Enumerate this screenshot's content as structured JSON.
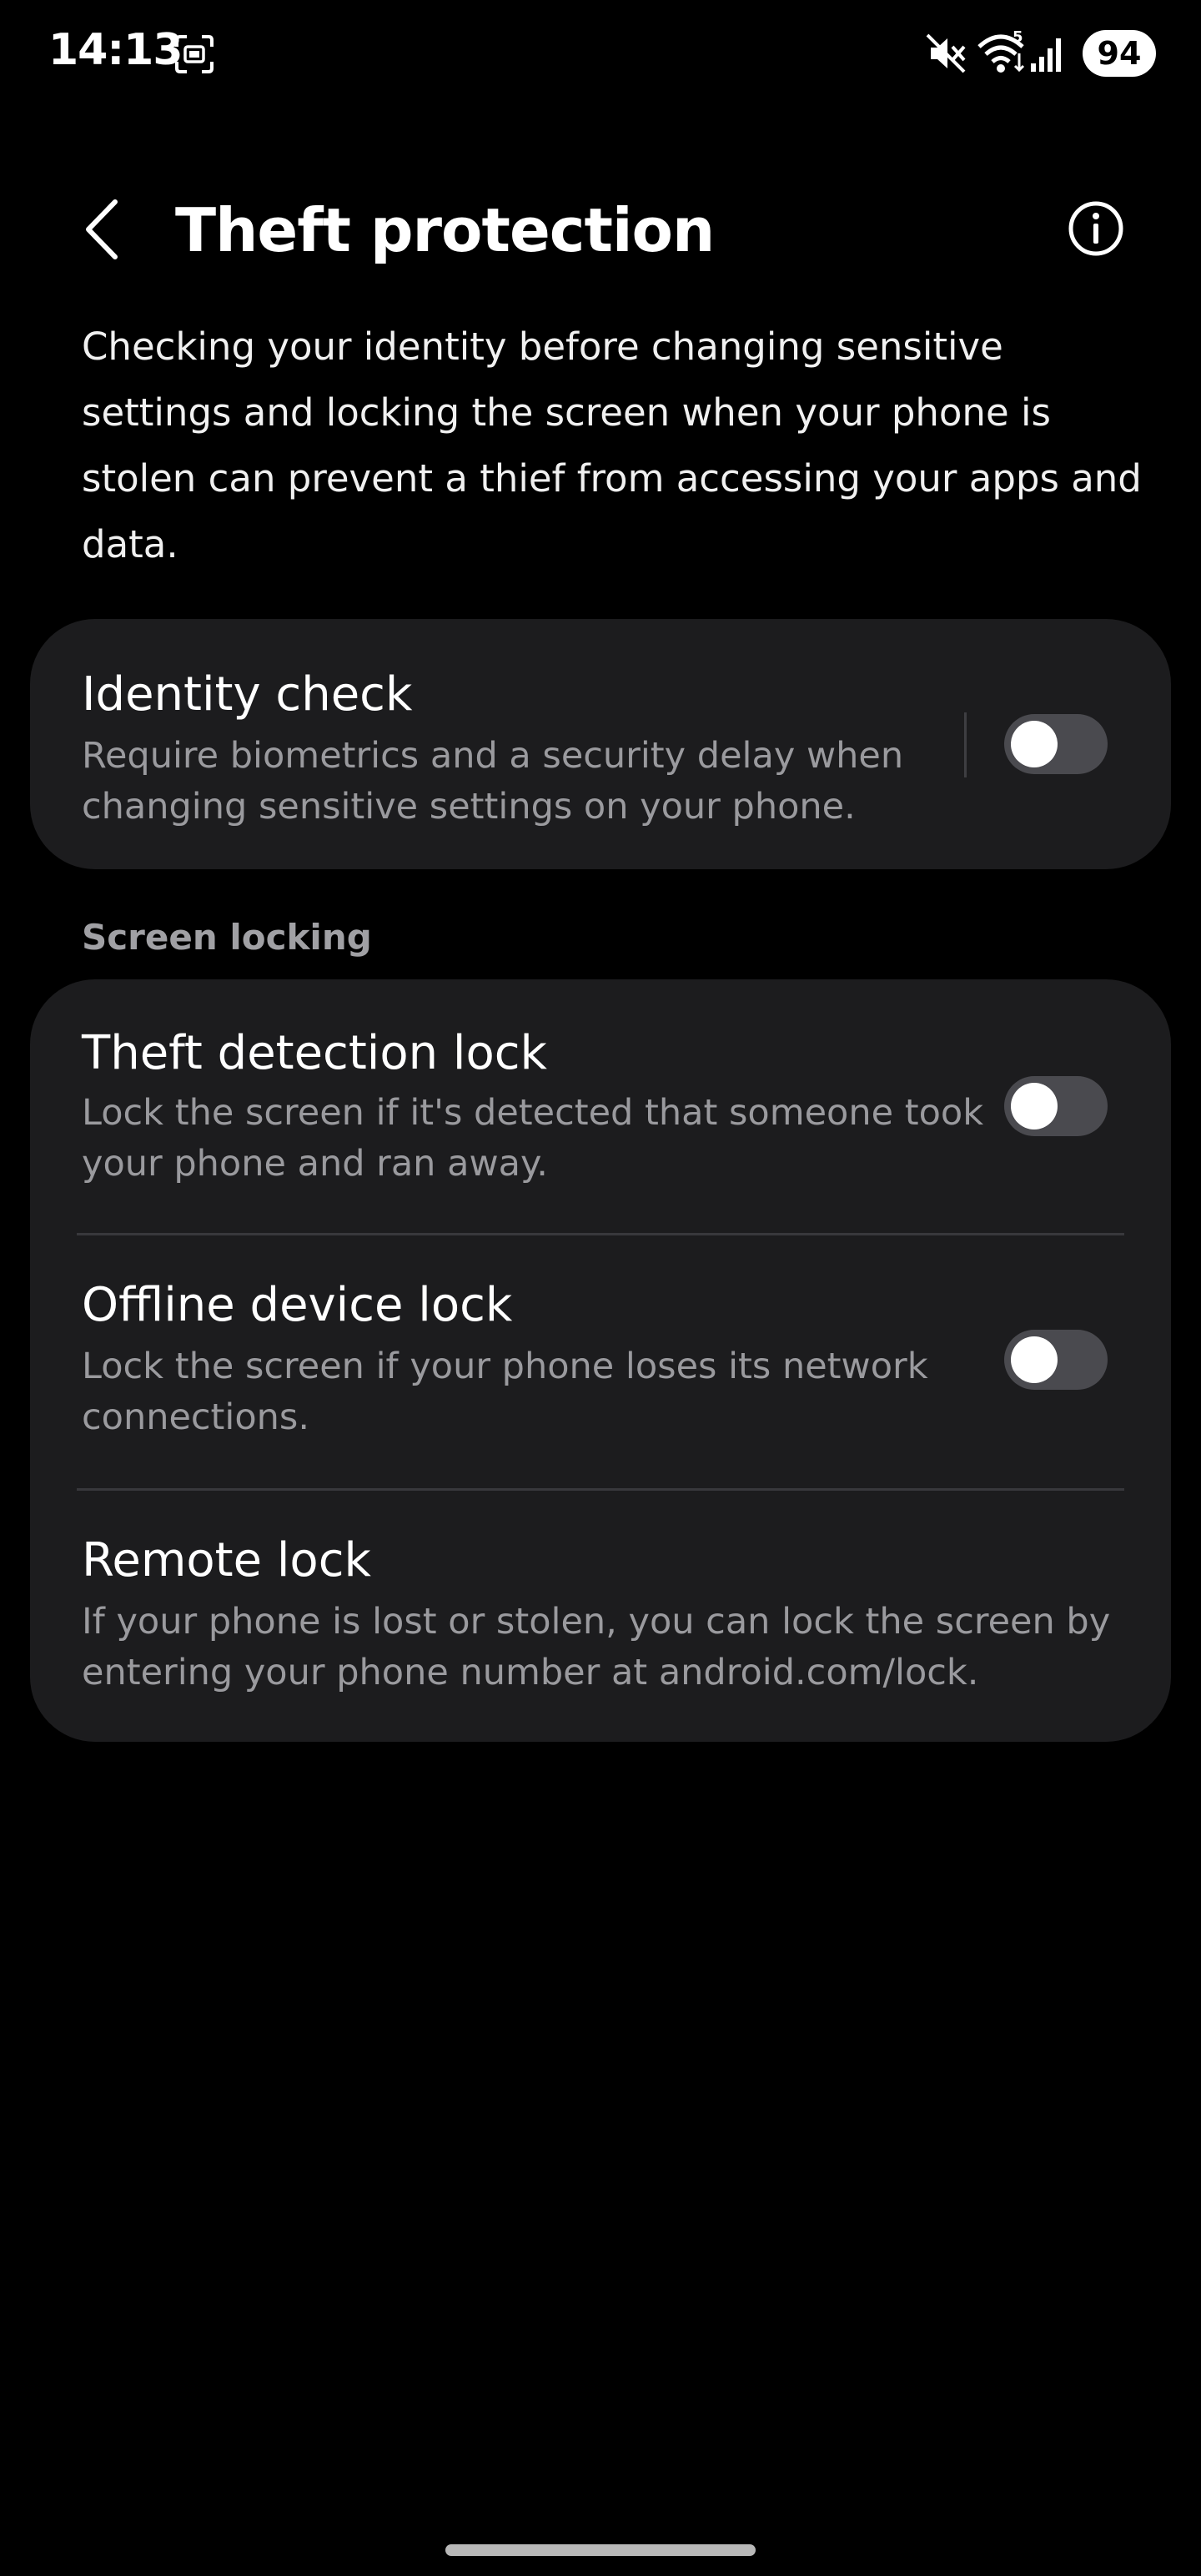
{
  "status_bar": {
    "time": "14:13",
    "battery": "94",
    "icons": [
      "screenshot-icon",
      "mute-icon",
      "wifi-icon",
      "signal-icon"
    ]
  },
  "header": {
    "title": "Theft protection",
    "back_icon": "chevron-left-icon",
    "info_icon": "info-icon"
  },
  "intro": "Checking your identity before changing sensitive settings and locking the screen when your phone is stolen can prevent a thief from accessing your apps and data.",
  "identity_check": {
    "title": "Identity check",
    "description": "Require biometrics and a security delay when changing sensitive settings on your phone.",
    "enabled": false
  },
  "screen_locking": {
    "label": "Screen locking",
    "items": [
      {
        "title": "Theft detection lock",
        "description": "Lock the screen if it's detected that someone took your phone and ran away.",
        "enabled": false
      },
      {
        "title": "Offline device lock",
        "description": "Lock the screen if your phone loses its network connections.",
        "enabled": false
      },
      {
        "title": "Remote lock",
        "description": "If your phone is lost or stolen, you can lock the screen by entering your phone number at android.com/lock."
      }
    ]
  },
  "colors": {
    "background": "#000000",
    "card": "#1c1c1e",
    "secondary_text": "#9a9a9e",
    "toggle_off": "#4a4a4f"
  }
}
